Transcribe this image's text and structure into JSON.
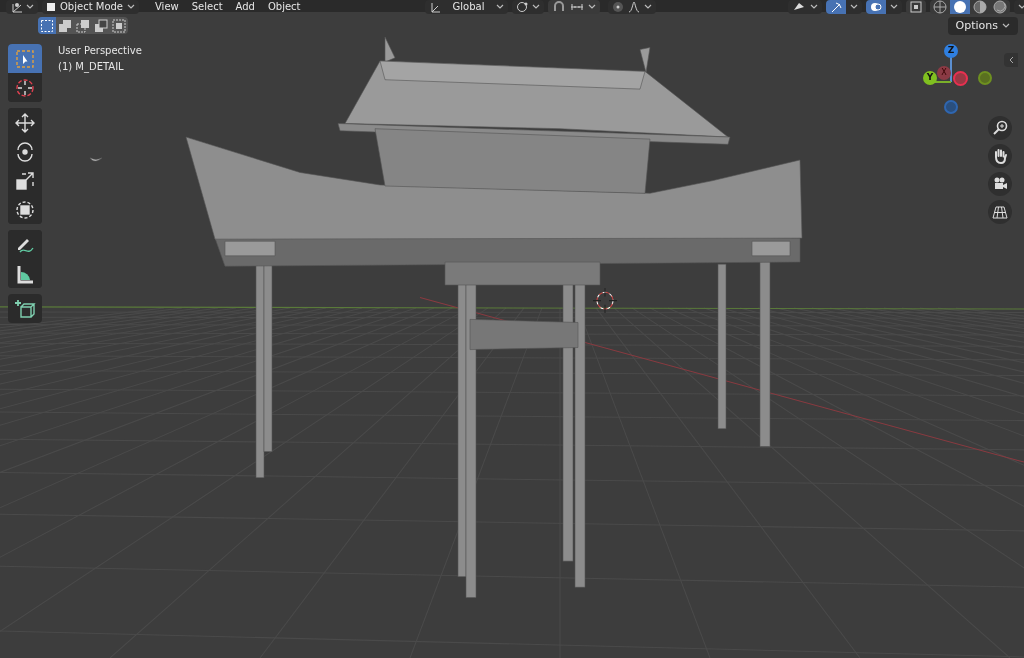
{
  "header": {
    "mode": "Object Mode",
    "menus": [
      "View",
      "Select",
      "Add",
      "Object"
    ],
    "orientation": "Global",
    "toggles": [
      {
        "kind": "gizmo",
        "on": true
      },
      {
        "kind": "overlay",
        "on": true
      }
    ],
    "shading": [
      {
        "kind": "wireframe",
        "selected": false
      },
      {
        "kind": "solid",
        "selected": true
      },
      {
        "kind": "material",
        "selected": false
      },
      {
        "kind": "rendered",
        "selected": false
      }
    ]
  },
  "tool_header": {
    "select_modes": [
      {
        "kind": "set",
        "selected": true
      },
      {
        "kind": "extend",
        "selected": false
      },
      {
        "kind": "subtract",
        "selected": false
      },
      {
        "kind": "invert",
        "selected": false
      },
      {
        "kind": "intersect",
        "selected": false
      }
    ],
    "options": "Options"
  },
  "viewport": {
    "view_name": "User Perspective",
    "object": "(1) M_DETAIL"
  },
  "tools": [
    {
      "kind": "select",
      "selected": true
    },
    {
      "kind": "cursor",
      "selected": false
    },
    {
      "kind": "move",
      "selected": false
    },
    {
      "kind": "rotate",
      "selected": false
    },
    {
      "kind": "scale",
      "selected": false
    },
    {
      "kind": "transform",
      "selected": false
    },
    {
      "kind": "annotate",
      "selected": false
    },
    {
      "kind": "measure",
      "selected": false
    },
    {
      "kind": "add-cube",
      "selected": false
    }
  ],
  "gizmo": {
    "z": "Z",
    "y": "Y",
    "x": "X"
  }
}
